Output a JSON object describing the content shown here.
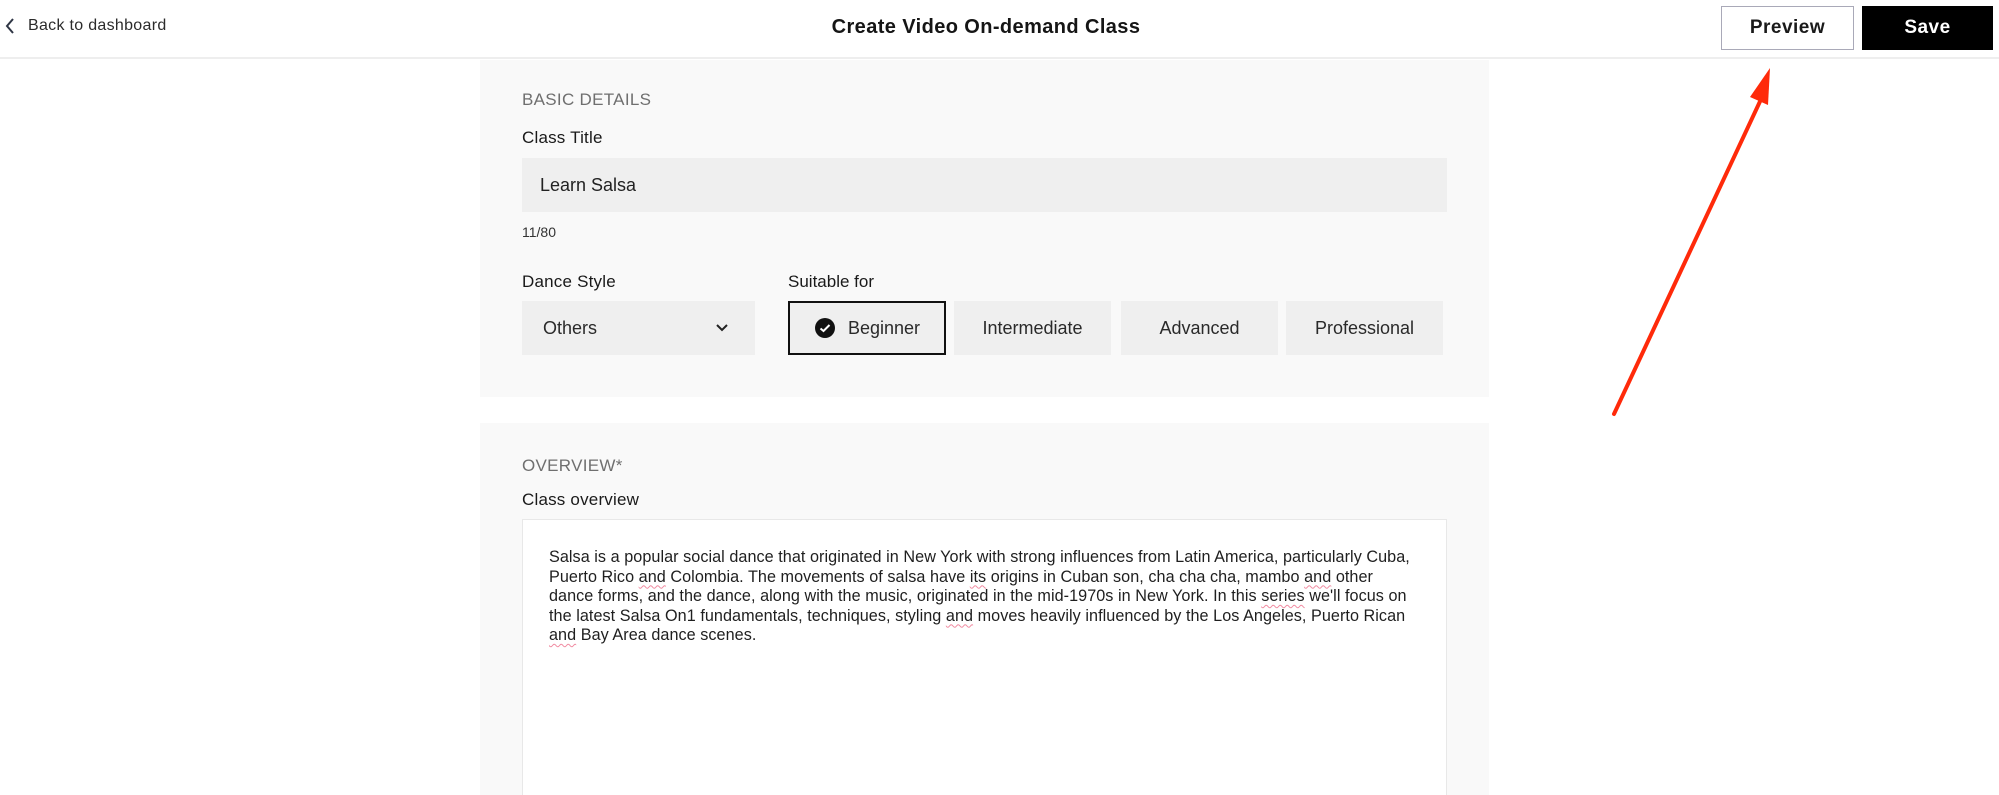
{
  "header": {
    "back_label": "Back to dashboard",
    "title": "Create Video On-demand Class",
    "preview_label": "Preview",
    "save_label": "Save"
  },
  "basic_details": {
    "section_title": "BASIC DETAILS",
    "class_title_label": "Class Title",
    "class_title_value": "Learn Salsa",
    "char_count": "11/80",
    "dance_style_label": "Dance Style",
    "dance_style_value": "Others",
    "suitable_for_label": "Suitable for",
    "levels": [
      {
        "label": "Beginner",
        "selected": true
      },
      {
        "label": "Intermediate",
        "selected": false
      },
      {
        "label": "Advanced",
        "selected": false
      },
      {
        "label": "Professional",
        "selected": false
      }
    ]
  },
  "overview": {
    "section_title": "OVERVIEW*",
    "class_overview_label": "Class overview",
    "segments": [
      "Salsa is a popular social dance that originated in New York with strong influences from Latin America, particularly Cuba, Puerto Rico ",
      "and",
      " Colombia. The movements of salsa have ",
      "its",
      " origins in Cuban son, cha cha cha, mambo ",
      "and",
      " other dance forms, and the dance, along with the music, originated in the mid-1970s in New York. In this ",
      "series",
      " we'll focus on the latest Salsa On1 fundamentals, techniques, styling ",
      "and",
      " moves heavily influenced by the Los Angeles, Puerto Rican ",
      "and",
      " Bay Area dance scenes."
    ]
  },
  "annotation": {
    "arrow_color": "#ff2a0a",
    "points_to": "Preview button"
  }
}
